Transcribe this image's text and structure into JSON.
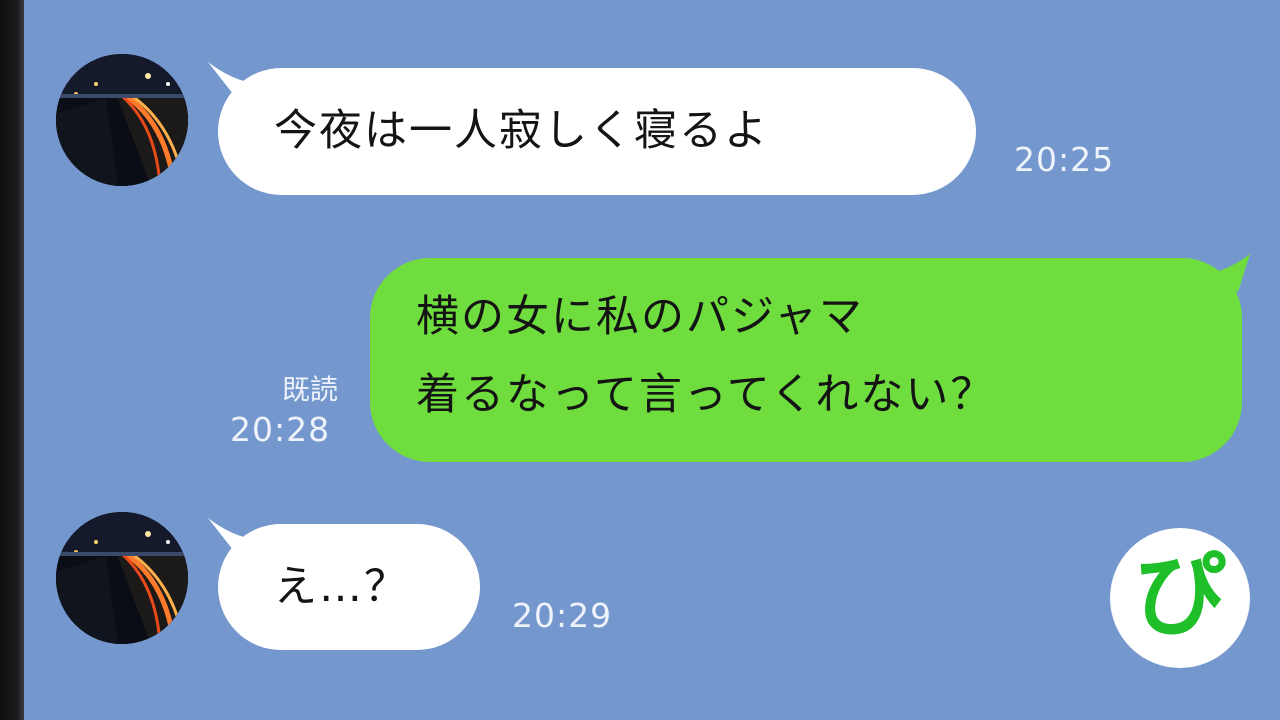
{
  "messages": [
    {
      "side": "left",
      "text": "今夜は一人寂しく寝るよ",
      "time": "20:25"
    },
    {
      "side": "right",
      "lines": [
        "横の女に私のパジャマ",
        "着るなって言ってくれない？"
      ],
      "read": "既読",
      "time": "20:28"
    },
    {
      "side": "left",
      "text": "え…？",
      "time": "20:29"
    }
  ],
  "badge": {
    "label": "ぴ"
  },
  "colors": {
    "background": "#7497ce",
    "bubble_in": "#ffffff",
    "bubble_out": "#6fdd3e",
    "badge_glyph": "#1fbf2a"
  }
}
